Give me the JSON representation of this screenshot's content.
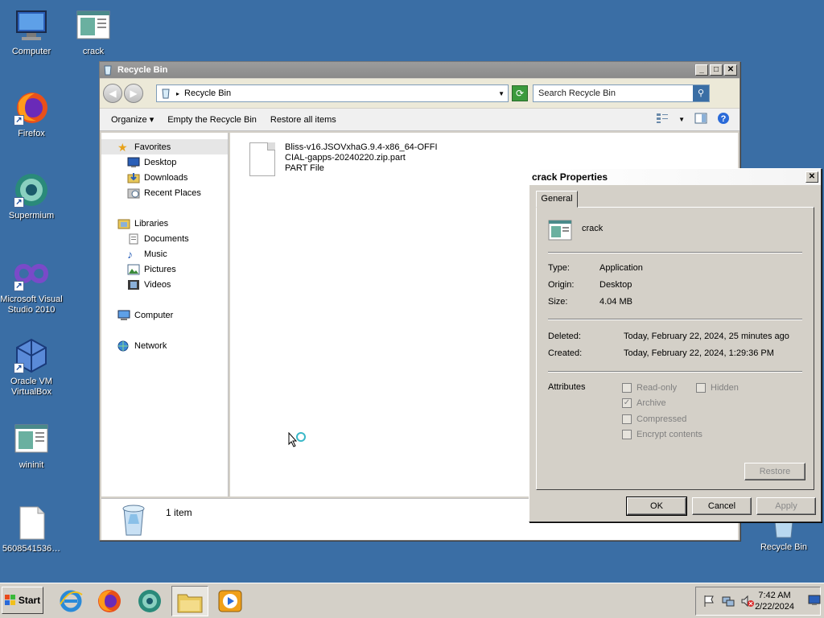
{
  "desktop": {
    "icons": [
      {
        "label": "Computer"
      },
      {
        "label": "crack"
      },
      {
        "label": "Firefox"
      },
      {
        "label": "Supermium"
      },
      {
        "label": "Microsoft Visual Studio 2010"
      },
      {
        "label": "Oracle VM VirtualBox"
      },
      {
        "label": "wininit"
      },
      {
        "label": "5608541536…"
      },
      {
        "label": "Recycle Bin"
      }
    ]
  },
  "explorer": {
    "title": "Recycle Bin",
    "address": "Recycle Bin",
    "search_placeholder": "Search Recycle Bin",
    "commands": [
      "Organize",
      "Empty the Recycle Bin",
      "Restore all items"
    ],
    "nav": {
      "favorites": "Favorites",
      "favorites_items": [
        "Desktop",
        "Downloads",
        "Recent Places"
      ],
      "libraries": "Libraries",
      "libraries_items": [
        "Documents",
        "Music",
        "Pictures",
        "Videos"
      ],
      "computer": "Computer",
      "network": "Network"
    },
    "file": {
      "name_line1": "Bliss-v16.JSOVxhaG.9.4-x86_64-OFFI",
      "name_line2": "CIAL-gapps-20240220.zip.part",
      "type": "PART File"
    },
    "item_count": "1 item"
  },
  "properties": {
    "title": "crack Properties",
    "tab": "General",
    "name": "crack",
    "type_label": "Type:",
    "type_value": "Application",
    "origin_label": "Origin:",
    "origin_value": "Desktop",
    "size_label": "Size:",
    "size_value": "4.04 MB",
    "deleted_label": "Deleted:",
    "deleted_value": "Today, February 22, 2024, 25 minutes ago",
    "created_label": "Created:",
    "created_value": "Today, February 22, 2024, 1:29:36 PM",
    "attributes_label": "Attributes",
    "attrs": {
      "readonly": "Read-only",
      "hidden": "Hidden",
      "archive": "Archive",
      "compressed": "Compressed",
      "encrypt": "Encrypt contents"
    },
    "restore": "Restore",
    "ok": "OK",
    "cancel": "Cancel",
    "apply": "Apply"
  },
  "taskbar": {
    "start": "Start",
    "time": "7:42 AM",
    "date": "2/22/2024"
  }
}
